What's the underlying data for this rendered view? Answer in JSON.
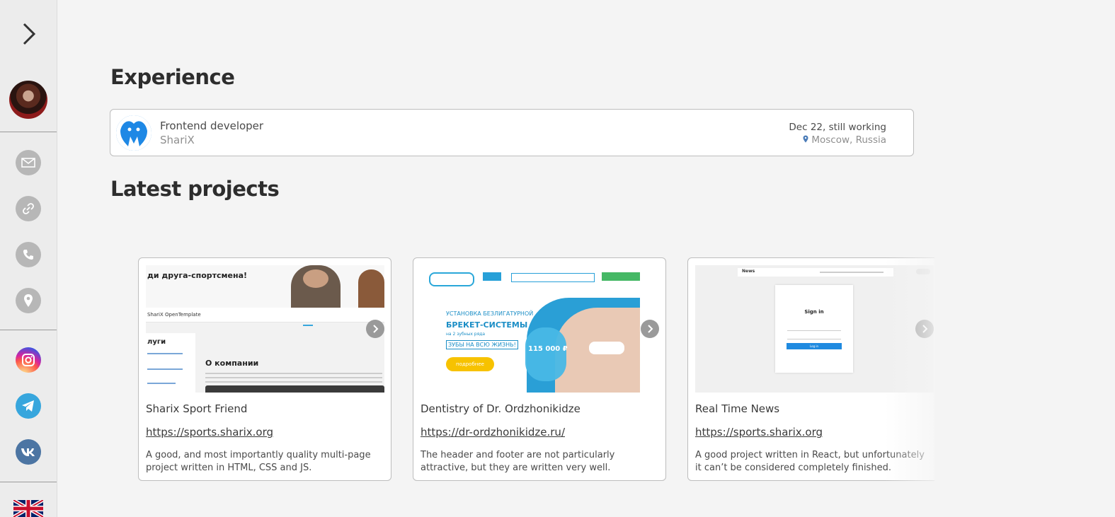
{
  "sidebar": {
    "toggle_icon": "chevron-right-icon",
    "contact_icons": [
      "mail-icon",
      "link-icon",
      "phone-icon",
      "location-icon"
    ],
    "social_icons": [
      "instagram-icon",
      "telegram-icon",
      "vk-icon"
    ],
    "language": "flag-uk-icon",
    "colors": {
      "instagram": "#d6249f",
      "telegram": "#37a6dd",
      "vk": "#4c75a3"
    }
  },
  "experience": {
    "heading": "Experience",
    "items": [
      {
        "role": "Frontend developer",
        "company": "ShariX",
        "dates": "Dec 22, still working",
        "location": "Moscow, Russia"
      }
    ]
  },
  "projects": {
    "heading": "Latest projects",
    "items": [
      {
        "title": "Sharix Sport Friend",
        "url": "https://sports.sharix.org",
        "description": "A good, and most importantly quality multi-page project written in HTML, CSS and JS.",
        "preview": {
          "headline": "ди друга-спортсмена!",
          "brand": "ShariX OpenTemplate",
          "section": "О компании",
          "side": "луги"
        }
      },
      {
        "title": "Dentistry of Dr. Ordzhonikidze",
        "url": "https://dr-ordzhonikidze.ru/",
        "description": "The header and footer are not particularly attractive, but they are written very well.",
        "preview": {
          "line1": "УСТАНОВКА БЕЗЛИГАТУРНОЙ",
          "line2": "БРЕКЕТ-СИСТЕМЫ",
          "line3": "на 2 зубных ряда",
          "badge": "ЗУБЫ НА ВСЮ ЖИЗНЬ!",
          "button": "подробнее",
          "price": "115 000 ₽"
        }
      },
      {
        "title": "Real Time News",
        "url": "https://sports.sharix.org",
        "description": "A good project written in React, but unfortunately it can’t be considered completely finished.",
        "preview": {
          "brand": "News",
          "form_title": "Sign in",
          "button": "Log in"
        }
      }
    ]
  }
}
